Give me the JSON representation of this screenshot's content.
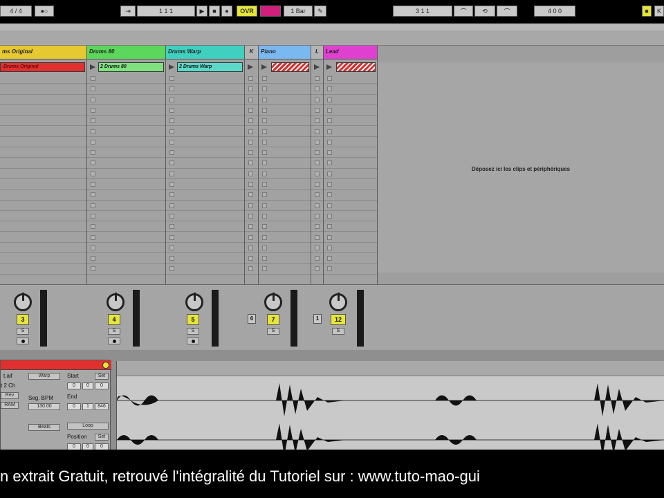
{
  "transport": {
    "signature": "4 / 4",
    "position": "1   1   1",
    "ovr": "OVR",
    "quantize": "1 Bar",
    "loop_start": "3   1   1",
    "loop_length": "4   0   0",
    "key": "K"
  },
  "tracks": [
    {
      "name": "ms Original",
      "color": "#e6c830",
      "clip": "Drums Original",
      "clip_color": "#e03030",
      "number": "3"
    },
    {
      "name": "Drums 80",
      "color": "#5bd85b",
      "clip": "2 Drums 80",
      "clip_color": "#7fe07f",
      "number": "4"
    },
    {
      "name": "Drums Warp",
      "color": "#40d0c0",
      "clip": "2 Drums Warp",
      "clip_color": "#5ad8c8",
      "number": "5"
    },
    {
      "name": "K",
      "number": "6"
    },
    {
      "name": "Piano",
      "color": "#7ab8f0",
      "number": "7"
    },
    {
      "name": "L",
      "number": "1"
    },
    {
      "name": "Lead",
      "color": "#e040d0",
      "number": "12"
    }
  ],
  "drop_zone": "Déposez ici les clips et périphériques",
  "solo_label": "S",
  "clip_view": {
    "file": "t.aif",
    "channels": "t 2 Ch",
    "rev": "Rev",
    "ram": "RAM",
    "warp": "Warp",
    "seg_bpm": "Seg. BPM",
    "bpm": "130.00",
    "beats": "Beats",
    "start": "Start",
    "set": "Set",
    "end": "End",
    "start_val": [
      "0",
      "0",
      "0"
    ],
    "end_val": [
      "0",
      "1",
      "846"
    ],
    "loop": "Loop",
    "position": "Position",
    "pos_val": [
      "0",
      "0",
      "0"
    ]
  },
  "footer": "n extrait Gratuit, retrouvé l'intégralité du Tutoriel sur :   www.tuto-mao-gui"
}
